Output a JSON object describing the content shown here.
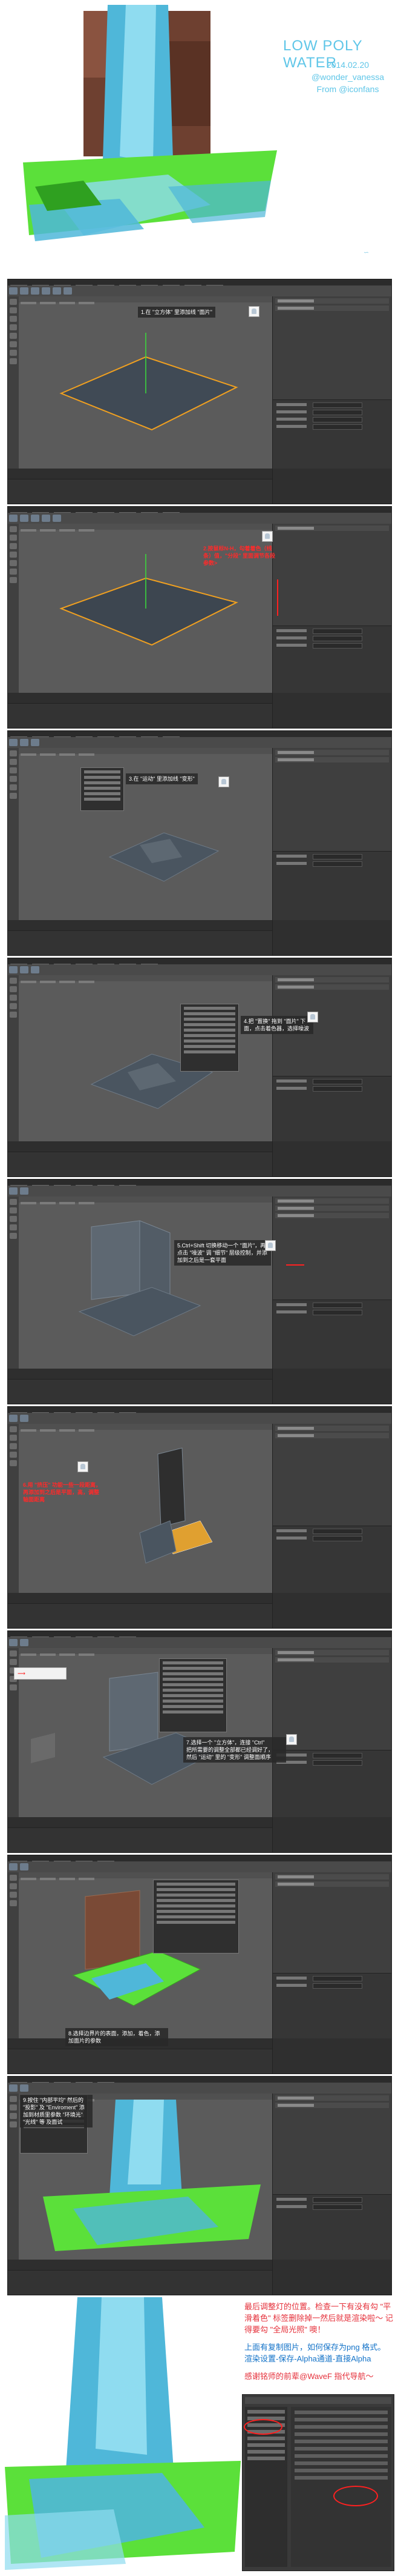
{
  "header": {
    "title": "LOW POLY WATER",
    "date": "2014.02.20",
    "author": "@wonder_vanessa",
    "source": "From @iconfans"
  },
  "steps": [
    {
      "text": "1.在 \"立方体\" 里添加线 \"面片\""
    },
    {
      "text": "2.按鼠标N-H，勾着着色（线条）值，\"分段\" 里面调节各段参数>"
    },
    {
      "text": "3.在 \"运动\" 里添加线 \"变形\""
    },
    {
      "text": "4.把 \"置换\" 拖到 \"面片\" 下面，点击着色器，选择噪波"
    },
    {
      "text": "5.Ctrl+Shift 切换移动一个 \"面片\"，再点击 \"噪波\" 调 \"细节\" 层级控制，并添加到之后是一套平面"
    },
    {
      "text": "6.用 \"挤压\" 功能一些一段距离，再添加到之后是平面，高，调整轴面距离"
    },
    {
      "text": "7.选择一个 \"立方体\"，连接 \"Ctrl\"\n把所需要的调整全部都已经调好了，\n然后 \"运动\" 里的 \"变形\" 调整面顺序"
    },
    {
      "text": "8.选择边界片的表面，添加，着色，添加面片的参数"
    },
    {
      "text": "9.按住 \"内部平均\" 然后的 \"投影\" 及 \"Enviroment\" 添加到材质里参数 \"环境光\" \"光线\" 等 及面试"
    }
  ],
  "final_notes": {
    "note1": "最后调整灯的位置。检查一下有没有勾 \"平滑着色\" 标签删除掉一然后就是渲染啦～ 记得要勾 \"全局光照\" 噢！",
    "note2": "上面有复制图片，如何保存为png 格式。渲染设置-保存-Alpha通道-直接Alpha",
    "thanks": "感谢铭师的前辈@WaveF 指代导航～"
  },
  "colors": {
    "accent": "#5fc6e8",
    "water": "#4fb7d9",
    "grass": "#5be03a",
    "wall": "#7a4a36",
    "note_red": "#e5303a",
    "note_blue": "#1473c8",
    "selection_orange": "#f0a020"
  }
}
